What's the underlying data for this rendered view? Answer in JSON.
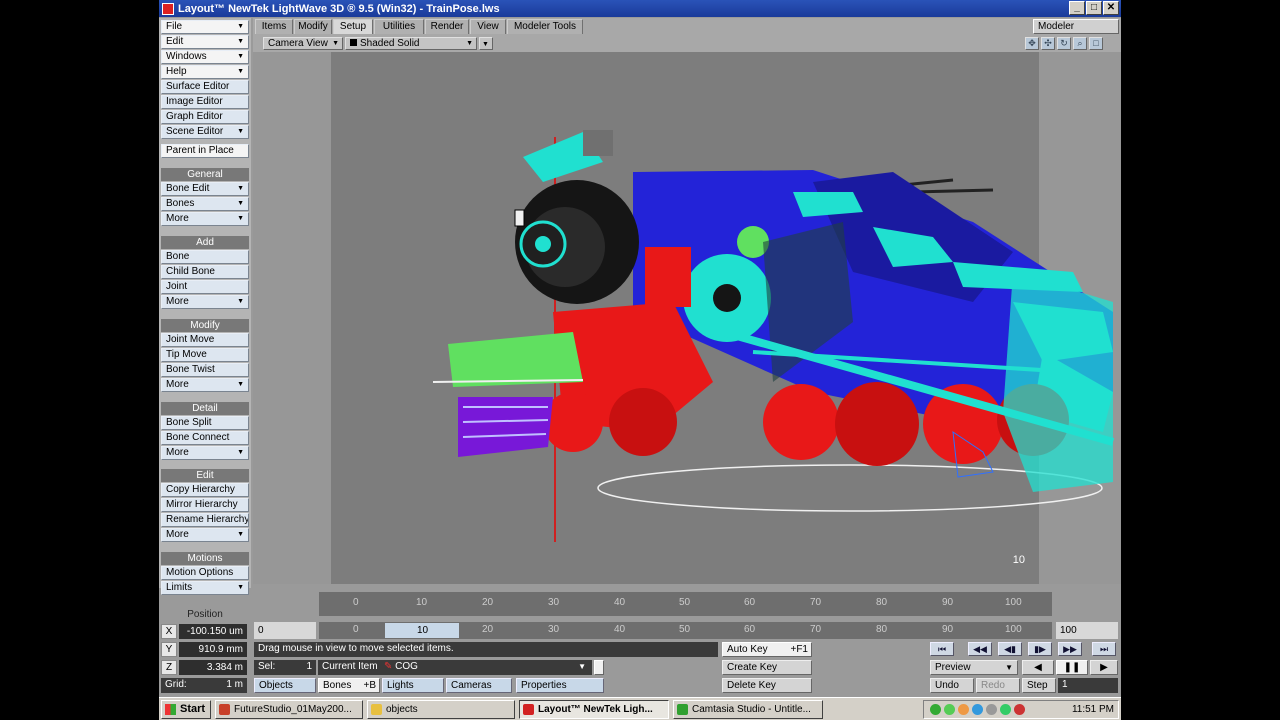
{
  "window": {
    "title": "Layout™ NewTek LightWave 3D ® 9.5  (Win32) - TrainPose.lws",
    "min": "_",
    "max": "□",
    "close": "✕"
  },
  "left_menu": {
    "top": [
      {
        "label": "File",
        "drop": true
      },
      {
        "label": "Edit",
        "drop": true
      },
      {
        "label": "Windows",
        "drop": true
      },
      {
        "label": "Help",
        "drop": true
      },
      {
        "label": "Surface Editor",
        "drop": false
      },
      {
        "label": "Image Editor",
        "drop": false
      },
      {
        "label": "Graph Editor",
        "drop": false
      },
      {
        "label": "Scene Editor",
        "drop": true
      }
    ],
    "parent_in_place": "Parent in Place",
    "general_header": "General",
    "general": [
      {
        "label": "Bone Edit"
      },
      {
        "label": "Bones"
      },
      {
        "label": "More"
      }
    ],
    "add_header": "Add",
    "add": [
      {
        "label": "Bone"
      },
      {
        "label": "Child Bone"
      },
      {
        "label": "Joint"
      },
      {
        "label": "More"
      }
    ],
    "modify_header": "Modify",
    "modify": [
      {
        "label": "Joint Move"
      },
      {
        "label": "Tip Move"
      },
      {
        "label": "Bone Twist"
      },
      {
        "label": "More"
      }
    ],
    "detail_header": "Detail",
    "detail": [
      {
        "label": "Bone Split"
      },
      {
        "label": "Bone Connect"
      },
      {
        "label": "More"
      }
    ],
    "edit_header": "Edit",
    "edit": [
      {
        "label": "Copy Hierarchy"
      },
      {
        "label": "Mirror Hierarchy"
      },
      {
        "label": "Rename Hierarchy"
      },
      {
        "label": "More"
      }
    ],
    "motions_header": "Motions",
    "motions": [
      {
        "label": "Motion Options"
      },
      {
        "label": "Limits"
      }
    ]
  },
  "tabs": [
    "Items",
    "Modify",
    "Setup",
    "Utilities",
    "Render",
    "View",
    "Modeler Tools"
  ],
  "active_tab": "Setup",
  "modeler_label": "Modeler",
  "viewport": {
    "view_type": "Camera View",
    "render_mode": "Shaded Solid",
    "frame_number": "10",
    "nav_icons": [
      "move-view-icon",
      "rotate-view-icon",
      "orbit-view-icon",
      "zoom-view-icon",
      "maximize-view-icon"
    ]
  },
  "timeline": {
    "ticks": [
      "0",
      "10",
      "20",
      "30",
      "40",
      "50",
      "60",
      "70",
      "80",
      "90",
      "100"
    ],
    "start": "0",
    "end": "100",
    "current": "10"
  },
  "position": {
    "label": "Position",
    "x_axis": "X",
    "x_value": "-100.150 um",
    "y_axis": "Y",
    "y_value": "910.9 mm",
    "z_axis": "Z",
    "z_value": "3.384 m",
    "grid_label": "Grid:",
    "grid_value": "1 m"
  },
  "status": {
    "message": "Drag mouse in view to move selected items.",
    "sel_label": "Sel:",
    "sel_value": "1",
    "current_item_label": "Current Item",
    "current_item_value": "COG"
  },
  "item_types": {
    "objects": "Objects",
    "bones": "Bones",
    "bones_shortcut": "+B",
    "lights": "Lights",
    "cameras": "Cameras",
    "properties": "Properties"
  },
  "keys": {
    "auto_key": "Auto Key",
    "auto_key_shortcut": "+F1",
    "create_key": "Create Key",
    "delete_key": "Delete Key"
  },
  "playback": {
    "buttons": [
      "⏮",
      "◀◀",
      "◀▮",
      "▮▶",
      "▶▶",
      "⏭"
    ],
    "preview": "Preview",
    "play_back": "◀",
    "pause": "❚❚",
    "play_fwd": "▶",
    "undo": "Undo",
    "redo": "Redo",
    "step_label": "Step",
    "step_value": "1"
  },
  "taskbar": {
    "start": "Start",
    "items": [
      {
        "label": "FutureStudio_01May200...",
        "color": "#c8402a"
      },
      {
        "label": "objects",
        "color": "#e8c040"
      },
      {
        "label": "Layout™ NewTek Ligh...",
        "color": "#d22222"
      },
      {
        "label": "Camtasia Studio - Untitle...",
        "color": "#30a030"
      }
    ],
    "active_index": 2,
    "clock": "11:51 PM"
  },
  "scene_colors": {
    "blue": "#2323d8",
    "navy": "#1a1aa0",
    "cyan": "#20e0d0",
    "red": "#e81818",
    "green": "#60e060",
    "black": "#151515",
    "purple": "#7818d8"
  }
}
